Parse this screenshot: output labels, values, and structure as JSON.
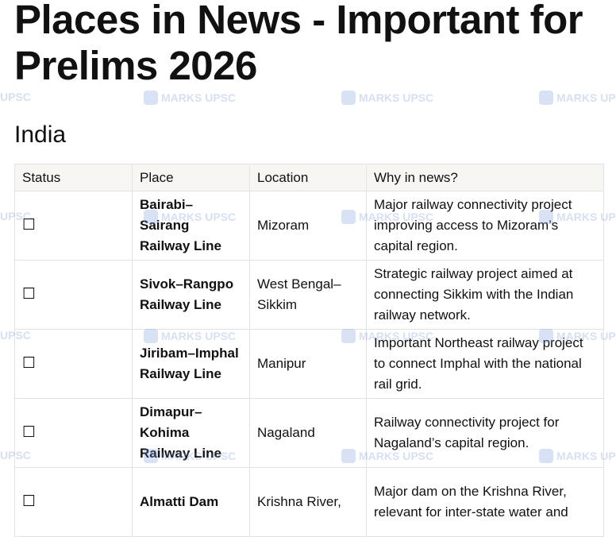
{
  "page": {
    "title": "Places in News - Important for Prelims 2026"
  },
  "section": {
    "heading": "India"
  },
  "table": {
    "headers": [
      "Status",
      "Place",
      "Location",
      "Why in news?"
    ],
    "rows": [
      {
        "status": "☐",
        "place": "Bairabi–Sairang Railway Line",
        "location": "Mizoram",
        "why": "Major railway connectivity project improving access to Mizoram’s capital region."
      },
      {
        "status": "☐",
        "place": "Sivok–Rangpo Railway Line",
        "location": "West Bengal–Sikkim",
        "why": "Strategic railway project aimed at connecting Sikkim with the Indian railway network."
      },
      {
        "status": "☐",
        "place": "Jiribam–Imphal Railway Line",
        "location": "Manipur",
        "why": "Important Northeast railway project to connect Imphal with the national rail grid."
      },
      {
        "status": "☐",
        "place": "Dimapur–Kohima Railway Line",
        "location": "Nagaland",
        "why": "Railway connectivity project for Nagaland’s capital region."
      },
      {
        "status": "☐",
        "place": "Almatti Dam",
        "location": "Krishna River,",
        "why": "Major dam on the Krishna River, relevant for inter-state water and"
      }
    ]
  },
  "watermark": {
    "text": "MARKS UPSC",
    "partial_text": "UPSC"
  }
}
